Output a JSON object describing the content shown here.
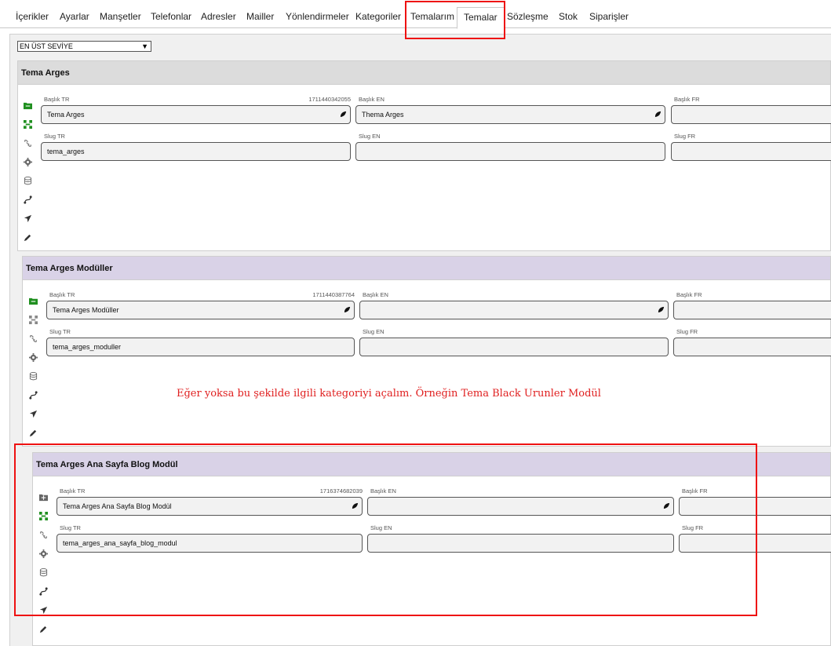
{
  "nav": {
    "tabs": [
      "İçerikler",
      "Ayarlar",
      "Manşetler",
      "Telefonlar",
      "Adresler",
      "Mailler",
      "Yönlendirmeler",
      "Kategoriler",
      "Temalarım",
      "Temalar",
      "Sözleşme",
      "Stok",
      "Siparişler"
    ],
    "active_tab": "Temalar"
  },
  "level_select": {
    "value": "EN ÜST SEVİYE"
  },
  "annotation_note": "Eğer yoksa bu şekilde ilgili kategoriyi açalım. Örneğin Tema Black Urunler Modül",
  "labels": {
    "baslik_tr": "Başlık TR",
    "baslik_en": "Başlık EN",
    "baslik_fr": "Başlık FR",
    "slug_tr": "Slug TR",
    "slug_en": "Slug EN",
    "slug_fr": "Slug FR"
  },
  "panels": [
    {
      "title": "Tema Arges",
      "id": "1711440342055",
      "baslik_tr": "Tema Arges",
      "baslik_en": "Thema Arges",
      "baslik_fr": "",
      "slug_tr": "tema_arges",
      "slug_en": "",
      "slug_fr": ""
    },
    {
      "title": "Tema Arges Modüller",
      "id": "1711440387764",
      "baslik_tr": "Tema Arges Modüller",
      "baslik_en": "",
      "baslik_fr": "",
      "slug_tr": "tema_arges_moduller",
      "slug_en": "",
      "slug_fr": ""
    },
    {
      "title": "Tema Arges Ana Sayfa Blog Modül",
      "id": "1716374682039",
      "baslik_tr": "Tema Arges Ana Sayfa Blog Modül",
      "baslik_en": "",
      "baslik_fr": "",
      "slug_tr": "tema_arges_ana_sayfa_blog_modul",
      "slug_en": "",
      "slug_fr": ""
    }
  ],
  "colors": {
    "accent_green": "#1f8f1f",
    "highlight_red": "#ee1111",
    "header_purple": "#d9d2e7",
    "header_grey": "#dcdcdc"
  },
  "icons": [
    "folder-icon",
    "sitemap-icon",
    "link-icon",
    "gear-icon",
    "database-icon",
    "route-icon",
    "send-icon",
    "edit-icon",
    "leaf-icon"
  ]
}
